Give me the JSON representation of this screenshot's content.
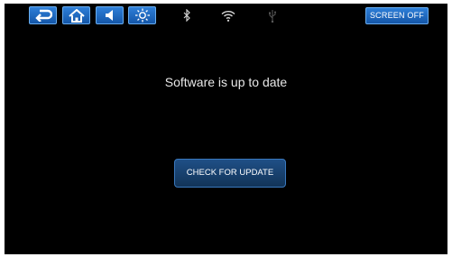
{
  "statusbar": {
    "nav_buttons": [
      {
        "icon": "back-icon"
      },
      {
        "icon": "home-icon"
      },
      {
        "icon": "volume-icon"
      },
      {
        "icon": "brightness-icon"
      }
    ],
    "status_icons": [
      "bluetooth-icon",
      "wifi-icon",
      "usb-icon"
    ],
    "screen_off_label": "SCREEN OFF"
  },
  "main": {
    "status_message": "Software is up to date",
    "check_update_label": "CHECK FOR UPDATE"
  },
  "colors": {
    "background": "#000000",
    "button_blue": "#1f6fd0",
    "button_border": "#6aaef0",
    "check_button": "#1a4677"
  }
}
